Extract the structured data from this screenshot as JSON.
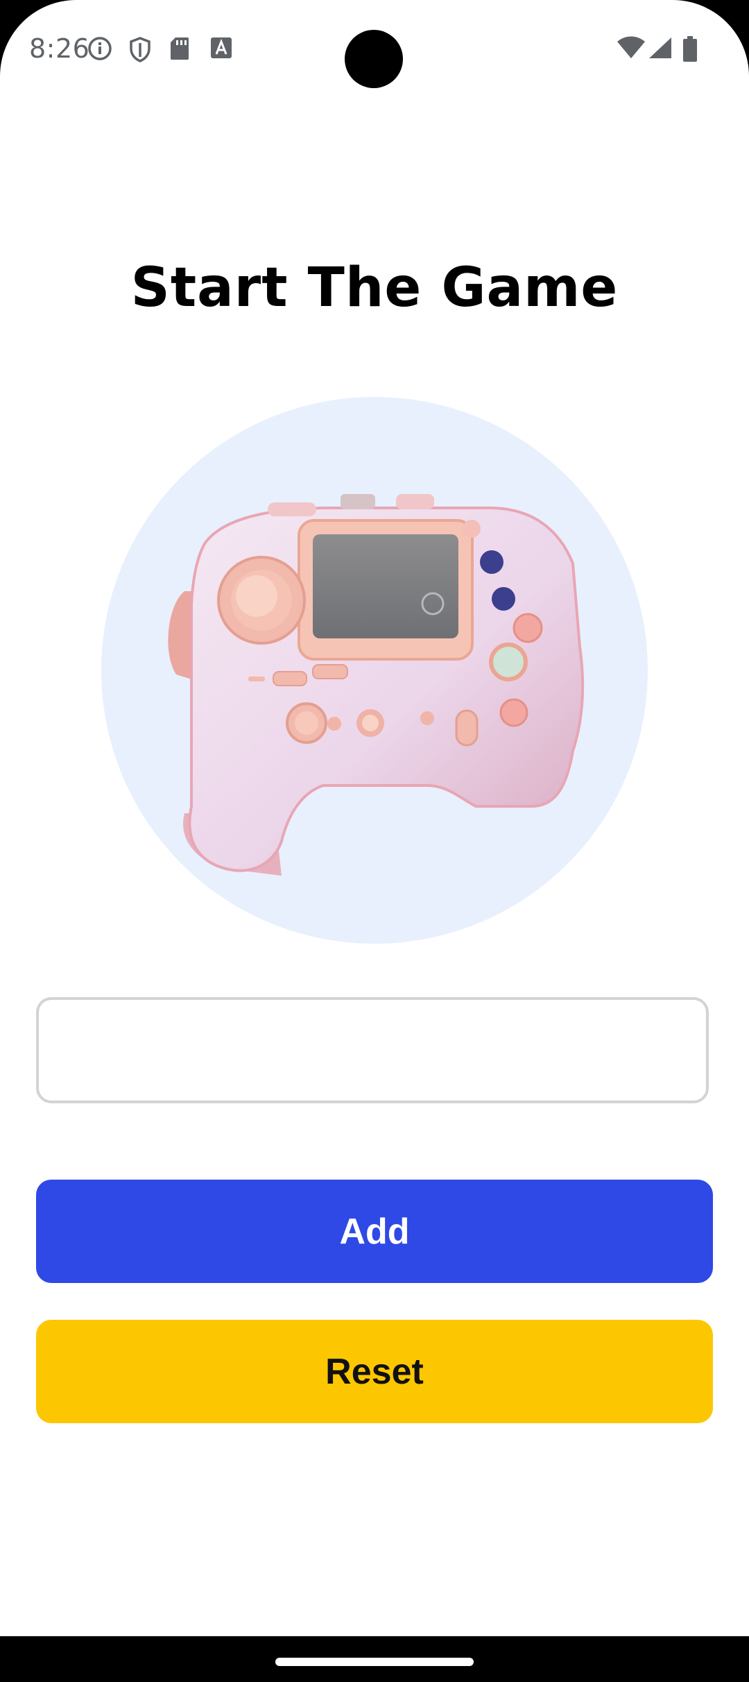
{
  "status_bar": {
    "time": "8:26",
    "left_icons": [
      "info-icon",
      "shield-icon",
      "sd-card-icon",
      "keyboard-a-icon"
    ],
    "right_icons": [
      "wifi-icon",
      "signal-icon",
      "battery-icon"
    ]
  },
  "page": {
    "title": "Start The Game"
  },
  "hero": {
    "image": "game-controller-illustration",
    "background_color": "#e8f0fd"
  },
  "input": {
    "value": "",
    "placeholder": ""
  },
  "buttons": {
    "add_label": "Add",
    "reset_label": "Reset"
  },
  "colors": {
    "add_button": "#2f49e6",
    "reset_button": "#fdc700"
  }
}
